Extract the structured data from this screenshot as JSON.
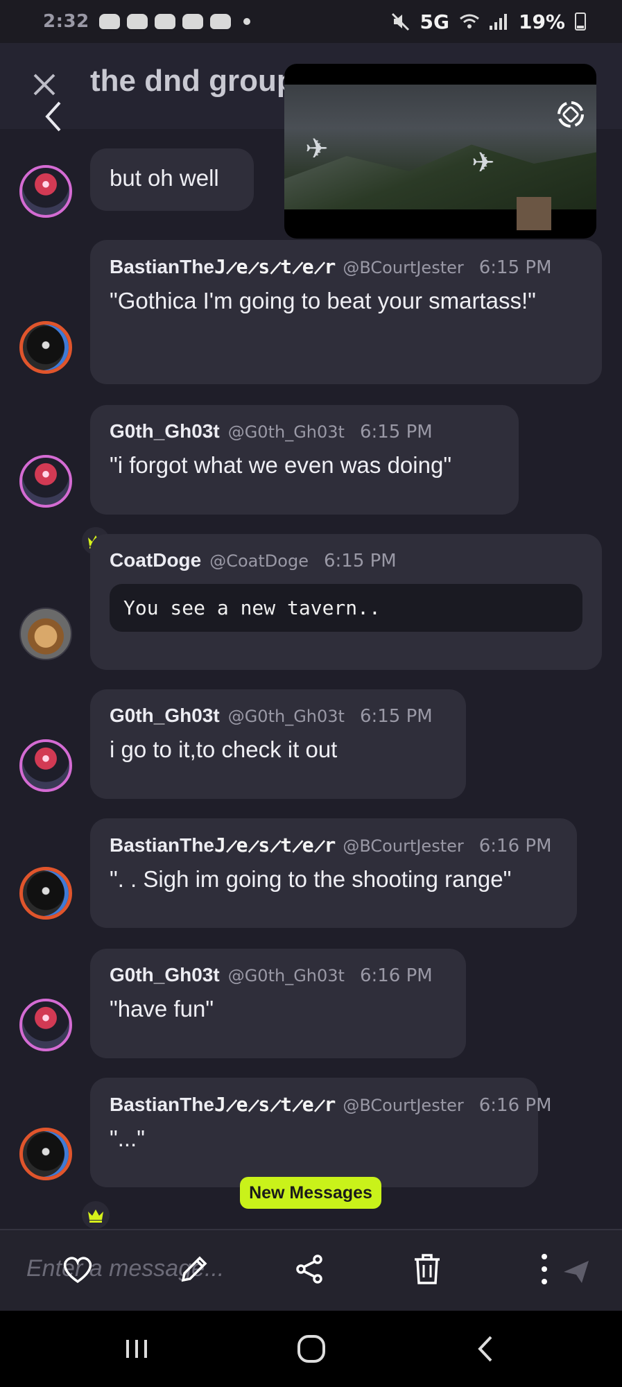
{
  "status_bar": {
    "time": "2:32",
    "network": "5G",
    "battery": "19%"
  },
  "header": {
    "title": "the dnd group"
  },
  "messages": [
    {
      "text": "but oh well"
    },
    {
      "name_prefix": "BastianThe",
      "name_glitch": "J̷e̷s̷t̷e̷r",
      "handle": "@BCourtJester",
      "time": "6:15 PM",
      "text": "\"Gothica I'm going to beat your smartass!\""
    },
    {
      "name": "G0th_Gh03t",
      "handle": "@G0th_Gh03t",
      "time": "6:15 PM",
      "text": "\"i forgot what we even was doing\""
    },
    {
      "name": "CoatDoge",
      "handle": "@CoatDoge",
      "time": "6:15 PM",
      "code": "You see a new tavern.."
    },
    {
      "name": "G0th_Gh03t",
      "handle": "@G0th_Gh03t",
      "time": "6:15 PM",
      "text": "i go to it,to check it out"
    },
    {
      "name_prefix": "BastianThe",
      "name_glitch": "J̷e̷s̷t̷e̷r",
      "handle": "@BCourtJester",
      "time": "6:16 PM",
      "text": "\". . Sigh im going to the shooting range\""
    },
    {
      "name": "G0th_Gh03t",
      "handle": "@G0th_Gh03t",
      "time": "6:16 PM",
      "text": "\"have fun\""
    },
    {
      "name_prefix": "BastianThe",
      "name_glitch": "J̷e̷s̷t̷e̷r",
      "handle": "@BCourtJester",
      "time": "6:16 PM",
      "text": "\"...\""
    }
  ],
  "new_messages_label": "New Messages",
  "composer": {
    "placeholder": "Enter a message..."
  },
  "colors": {
    "background": "#1f1e29",
    "bubble": "#2f2e3a",
    "accent": "#c9f21a",
    "crown": "#d6f21b"
  },
  "icons": [
    "close-icon",
    "back-icon",
    "rotate-icon",
    "heart-icon",
    "pencil-icon",
    "share-icon",
    "trash-icon",
    "more-icon",
    "send-icon",
    "crown-icon"
  ]
}
